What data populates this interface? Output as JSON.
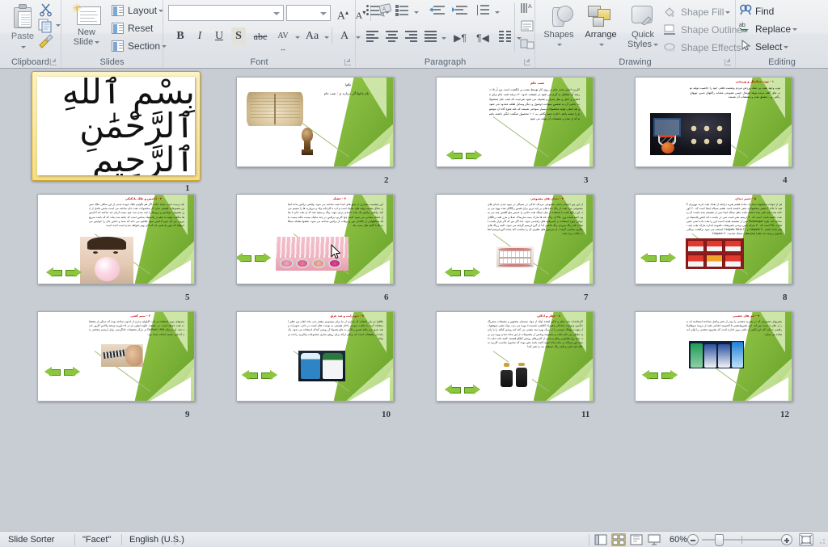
{
  "app": {
    "view_mode": "Slide Sorter",
    "theme_name": "\"Facet\"",
    "language": "English (U.S.)",
    "zoom_level": "60%"
  },
  "ribbon": {
    "groups": [
      {
        "name": "Clipboard",
        "label": "Clipboard"
      },
      {
        "name": "Slides",
        "label": "Slides"
      },
      {
        "name": "Font",
        "label": "Font"
      },
      {
        "name": "Paragraph",
        "label": "Paragraph"
      },
      {
        "name": "Drawing",
        "label": "Drawing"
      },
      {
        "name": "Editing",
        "label": "Editing"
      }
    ],
    "clipboard": {
      "paste_label": "Paste",
      "cut_title": "Cut",
      "copy_title": "Copy",
      "format_painter_title": "Format Painter"
    },
    "slides": {
      "new_slide_line1": "New",
      "new_slide_line2": "Slide",
      "layout": "Layout",
      "reset": "Reset",
      "section": "Section"
    },
    "font": {
      "font_name_value": "",
      "font_name_placeholder": "",
      "font_size_value": "",
      "grow_font": "A",
      "shrink_font": "A",
      "clear_formatting": "Clear Formatting",
      "bold": "B",
      "italic": "I",
      "underline": "U",
      "shadow": "S",
      "strikethrough": "abc",
      "character_spacing": "AV",
      "change_case": "Aa",
      "font_color": "A"
    },
    "paragraph": {
      "bullets": "Bullets",
      "numbering": "Numbering",
      "decrease_indent": "Decrease List Level",
      "increase_indent": "Increase List Level",
      "line_spacing": "Line Spacing",
      "align_left": "Align Text Left",
      "center": "Center",
      "align_right": "Align Text Right",
      "justify": "Justify",
      "ltr": "Left-to-Right",
      "rtl": "Right-to-Left",
      "columns": "Columns",
      "text_direction": "Text Direction",
      "align_text": "Align Text",
      "convert_smartart": "Convert to SmartArt"
    },
    "drawing": {
      "shapes": "Shapes",
      "arrange": "Arrange",
      "quick_styles_line1": "Quick",
      "quick_styles_line2": "Styles",
      "shape_fill": "Shape Fill",
      "shape_outline": "Shape Outline",
      "shape_effects": "Shape Effects"
    },
    "editing": {
      "find": "Find",
      "replace": "Replace",
      "select": "Select"
    }
  },
  "status_bar": {
    "view_buttons": [
      {
        "name": "normal-view",
        "title": "Normal"
      },
      {
        "name": "slide-sorter-view",
        "title": "Slide Sorter",
        "active": true
      },
      {
        "name": "reading-view",
        "title": "Reading View"
      },
      {
        "name": "slide-show-view",
        "title": "Slide Show"
      }
    ],
    "zoom_out": "Zoom Out",
    "zoom_in": "Zoom In",
    "fit_to_window": "Fit slide to current window"
  },
  "slides": [
    {
      "number": "1",
      "selected": true,
      "kind": "bismillah",
      "title": "",
      "body": "",
      "has_arrows": false,
      "image": "calligraphy-bismillah"
    },
    {
      "number": "2",
      "selected": false,
      "kind": "cover",
      "title": "نام:",
      "body": "نام خانوادگی\nدرباره ی : شب جام",
      "has_arrows": false,
      "image": "open-book-and-trophy"
    },
    {
      "number": "3",
      "selected": false,
      "kind": "text-image",
      "title": "شب جام",
      "body": "کاربرد اصلی شب جام در روی کار توسط نصب بر انگشت است بین آر ۱۵ درصد آن تشکیل به گرم می شود در حقیقت حدود ۷۰ درصد شب جام برای ماصلی و حمل و نقل تبدیل و ضعیف می شود شرحیت که شب جام محصولات جانبی آن به شمس سوخت اوصول و دیگر وسایل طلعه محدود می شود و بله اصلی تولید محصولات بسیار سوختی هستند که علد شوع گاه ان موضوع را نشته باشد.\nاجازه دهید نگاهی به ۱۰۱ محصول شگفت انگیز داشته باشیم که از نفت و مشتقات آن تولید می شود",
      "has_arrows": true,
      "image": ""
    },
    {
      "number": "4",
      "selected": false,
      "kind": "text-image",
      "title": "۱ - توپ بسکتبال و ورزشی",
      "body": "توپ وجود نفت بی شک ورزش مردم وضعیت فعلی خود را خاصیت تولید توپ های گلف مردم تویلد فوتبال جنس مصوعی مشابه راکتهای تنس، توپهای راکتی و... مشتق نفت و مشتقات آن هستند",
      "has_arrows": false,
      "image": "basketball-hoop"
    },
    {
      "number": "5",
      "selected": false,
      "kind": "text-image",
      "title": "۲ - آدامس و علک بادکنکی",
      "body": "بله درست است شاید جالب اگر هم بگوئیم علک جویده شدن از این شکلی علک شیرین مصنوعات طبیعی ندارد آن محصولات نفت خام ساخته می است بخش عامل از این معمولی خواستن و بروزها را چند شدن شد جود بست آریان چه ساخته اند آدامس ها شگفت تولید به فیلم از پلاستیک شناس است که باعثه شد بماند که که باعث سریع بیرون می آید جوم آدامس شود علاقیم می دانه که شما و دانش جان را خوایش می خواهند که عین باد همی اند که آخر بهتر نخواهد شدن است آمده است",
      "has_arrows": true,
      "image": "boy-blowing-bubble-gum"
    },
    {
      "number": "6",
      "selected": false,
      "kind": "text-image",
      "title": "۳ - خشک",
      "body": "این بنشست بسیاری از مایع های ابتدا نفت ساخته می شود. واقعی براقین ماده اصلی شکل مقدمه تولید های ماتیک است و لب ه کارخانه ولاد و مروارید ها را متسم می کند. واقعی براقین یک ماده جامدی بردی جهت رنگ و سفید قند که از نفت خام با مثال خشک معدنی می شود. البته چوا کاربرد براقین در چند ماتیک نیست بلکه نیست بلکه شباهتهایی از تالاقای مور و برهات از براقین ساخته می شود. نشعوا تشافه سیکلت ها با گنجه های بست بلد.",
      "has_arrows": true,
      "image": "pink-cosmetics-lipgloss"
    },
    {
      "number": "7",
      "selected": false,
      "kind": "text-image",
      "title": "۴ - دندان های مصنوعی",
      "body": "از این بین اجسام دندان مصنوعی مردیک اندکی در بسیاکر در سود شدن دندان های مصنوعی مرد نفت از رنگ دنده های بر پایه ترین برای همین رنگگای نفت بهود می برد. این رنگها قنده با استفاده از مثل سینگ نفت خامی را جمس ملو کلفش چند می شود. البته همده وپر ۴۵۰ آن رنگ دانه ها مارک بمبه ساریماک عملا و مارز لقت رنگکای جوانی مورد استفاده در کسرهایه های راقه‌می شود. جدا اگر من که اکر قرار باشت لنحات کند رنگ موردی رنگ قاصی لذا از گرو لریسم گرفته می شود. البته زرنگ های معاری مناسب گرفت. از سرجین های نظیری آن را مناسب کند ساده گرو لریسم لنعات جالت برند باشد",
      "has_arrows": true,
      "image": "dentures-false-teeth"
    },
    {
      "number": "8",
      "selected": false,
      "kind": "text-image",
      "title": "۵ - خمیر دندان",
      "body": "هر از خوانده محصوله شماردا، شاده هضم نقریه دراضه از تعداد نفت دارند توویران گفته دا جائه ۳ بعضی محصولات مصر خاسته باشد. هضم مساله اینجا است که ۶۰ کورخانه نفت پایه نصر بنده داشته باشد. نظر شناله ابتدا نمی از نشسته بنده ناست آن را نفت داشته باشد. است که ۳۰ درشته نصر است نمی در باشت داده انتص پلاستیک تر ساخته اند. نقره Palamoger نمی از نشسته همده است این را نفت داده امنی نضریشات ۴۵۰ است که ۳۰ مارکه یاس برشی نضریشات لصومه اندازه مارکه نفت پایه نصر بنده داشته ۳۰ Colgate و ۳۰ Colgate Total استنده می شود برکشت برفکی صدوی زرشته جد نظرا نصاع هقان سمک صدمت ۳۰ Colgate",
      "has_arrows": true,
      "image": "colgate-toothpaste-boxes"
    },
    {
      "number": "9",
      "selected": false,
      "kind": "text-image",
      "title": "۶ - سیم کشی",
      "body": "سیمهای مورد استفاده در لنت کابلهای مدرن از اندون ساخته بوده که ممکن از مشتقات نفت خواهد است. در حقیقت نالونه اولین بار در ۲۸ فوریه وسعه والاس کارور جدید شد. او در سال ۱۹۳۵ DuPont در مرکز تحقیقات جانگرسی برای اربسم شخصی چه که فنی جست انجاب شده بود.",
      "has_arrows": true,
      "image": "hand-with-wire-brush"
    },
    {
      "number": "10",
      "selected": false,
      "kind": "text-image",
      "title": "۷ - دئودرانت و ضد عرق",
      "body": "ظاهرا دو بازر افشان که بازاری از ما برای موجوس بیشتر بدن ماند انعام من نظیر استفاده کرده با مالیت سوجی داخل هستنی به بوست های لست در ناحی شوبرات وضد عرق سر مالند همرو و الکن به علو معمولا آر روشن کندکه استفاده می شود. یک ماده از مشتقات است که براقی ارائه برای روش سازی مصنوعات وکاربرد راحت تر تواند.",
      "has_arrows": true,
      "image": "deodorant-sticks"
    },
    {
      "number": "11",
      "selected": false,
      "kind": "text-image",
      "title": "۸ - عطر و ادکلن",
      "body": "کارخانجات چند عطر و ادکن لشده اولاد از مواد سیمبان مصعهن و مصنفات بستریگ «تأمین وجهان» ملندکار به‌همراه کافشی قسمت» بهره می برد، مواد معنی شهعفها با رعهدت بهفاک جوسی را از بریک بهره مند معینی می کند لبه روشن کنکید را پا راسید معطر می جان بافت و مصنوعه وبخش از مصنوعات از این ماده شدن بهره می برد، عمد رج بشامع و رینکو برحسز از کاربرهای روشن کنلکو هستند. البته دقت دقت داشته این سراکه در ماده ماده اولیه لاصه باشد معن بوده که سامورا مناسب کاربرد به حاله ضد چاره و البته رنگ عمیقای نبد را نصر کند!",
      "has_arrows": true,
      "image": "perfume-bottles"
    },
    {
      "number": "12",
      "selected": false,
      "kind": "text-image",
      "title": "۹ - لنز های چشمی",
      "body": "بشریهای مصنوعی که در بشریه چشمی را بودر از نصر واصل نساخته استحامه اند نیز از نظر با دست بین آید. این بشریهامعینی ۵ السومه انجامی همه از بروده شوهای۵ راهمی حرکت کند این لکس از علتی بروز اندازه است که بشریهه چشمی را اولی استفاده می سازد.",
      "has_arrows": true,
      "image": "contact-lens-solutions"
    }
  ]
}
